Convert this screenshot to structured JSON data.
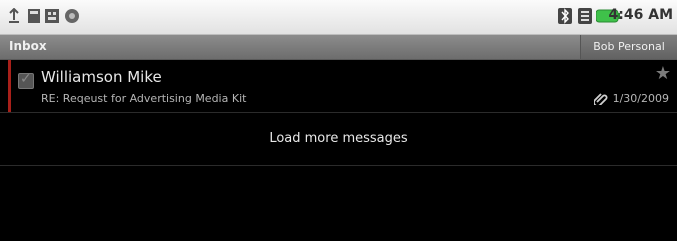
{
  "status_bar": {
    "left_icons": [
      "usb-icon",
      "sd-card-icon",
      "debug-icon",
      "record-icon"
    ],
    "right_icons": [
      "bluetooth-icon",
      "signal-icon",
      "battery-icon"
    ],
    "time": "4:46 AM"
  },
  "header": {
    "title": "Inbox",
    "account": "Bob Personal"
  },
  "messages": [
    {
      "sender": "Williamson Mike",
      "subject": "RE: Reqeust for Advertising Media Kit",
      "date": "1/30/2009",
      "has_attachment": true,
      "starred": false,
      "checked": true
    }
  ],
  "load_more_label": "Load more messages",
  "colors": {
    "unread_accent": "#a8201a",
    "battery_green": "#3fc14a"
  }
}
